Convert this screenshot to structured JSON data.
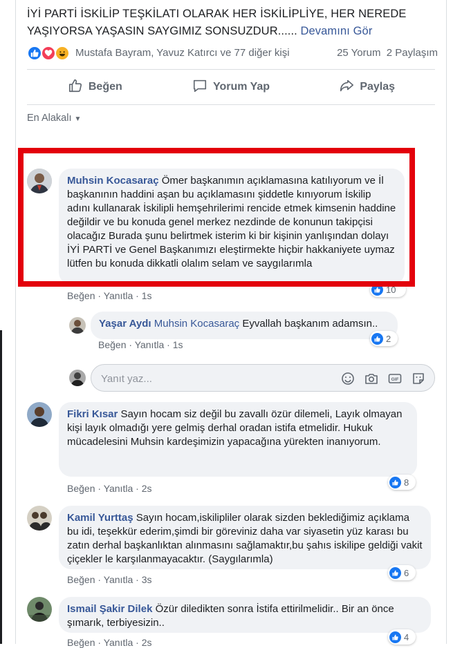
{
  "post": {
    "text_line1": "İYİ PARTİ İSKİLİP TEŞKİLATI OLARAK HER İSKİLİPLİYE, HER NEREDE",
    "text_line2": "YAŞIYORSA YAŞASIN SAYGIMIZ SONSUZDUR......",
    "see_more": "Devamını Gör",
    "reaction_names": "Mustafa Bayram, Yavuz Katırcı ve 77 diğer kişi",
    "comment_count": "25 Yorum",
    "share_count": "2 Paylaşım"
  },
  "actions": {
    "like": "Beğen",
    "comment": "Yorum Yap",
    "share": "Paylaş"
  },
  "sort": {
    "label": "En Alakalı"
  },
  "comments": [
    {
      "author": "Muhsin Kocasaraç",
      "text": "Ömer başkanımın açıklamasına katılıyorum ve İl başkanının haddini aşan bu açıklamasını şiddetle kınıyorum İskilip adını kullanarak İskilipli hemşehrilerimi rencide etmek kimsenin haddine değildir ve bu konuda genel merkez nezdinde de konunun takipçisi olacağız Burada şunu belirtmek isterim ki bir kişinin yanlışından dolayı İYİ PARTİ ve Genel Başkanımızı eleştirmekte hiçbir hakkaniyete uymaz lütfen bu konuda dikkatli olalım selam ve saygılarımla",
      "like": "Beğen",
      "reply": "Yanıtla",
      "time": "1s",
      "reactions": "10"
    },
    {
      "author": "Yaşar Aydı",
      "mention": "Muhsin Kocasaraç",
      "text": "Eyvallah başkanım adamsın..",
      "like": "Beğen",
      "reply": "Yanıtla",
      "time": "1s",
      "reactions": "2"
    },
    {
      "author": "Fikri Kısar",
      "text": "Sayın hocam siz değil bu zavallı özür dilemeli, Layık olmayan kişi layık olmadığı yere gelmiş derhal oradan istifa etmelidir. Hukuk mücadelesini Muhsin kardeşimizin yapacağına yürekten inanıyorum.",
      "like": "Beğen",
      "reply": "Yanıtla",
      "time": "2s",
      "reactions": "8"
    },
    {
      "author": "Kamil Yurttaş",
      "text": "Sayın hocam,iskilipliler olarak sizden beklediğimiz açıklama bu idi, teşekkür ederim,şimdi bir göreviniz daha var siyasetin yüz karası bu zatın derhal başkanlıktan alınmasını sağlamaktır,bu şahıs iskilipe geldiği vakit çiçekler le karşılanmayacaktır. (Saygılarımla)",
      "like": "Beğen",
      "reply": "Yanıtla",
      "time": "3s",
      "reactions": "6"
    },
    {
      "author": "Ismail Şakir Dilek",
      "text": "Özür diledikten sonra İstifa ettirilmelidir.. Bir an önce şımarık, terbiyesizin..",
      "like": "Beğen",
      "reply": "Yanıtla",
      "time": "2s",
      "reactions": "4"
    }
  ],
  "reply_box": {
    "placeholder": "Yanıt yaz..."
  },
  "icons": {
    "like": "thumbs-up-icon",
    "comment": "speech-bubble-icon",
    "share": "share-arrow-icon",
    "emoji": "smiley-icon",
    "camera": "camera-icon",
    "gif": "gif-icon",
    "sticker": "sticker-icon"
  },
  "colors": {
    "link": "#385898",
    "like_blue": "#1877f2",
    "highlight_red": "#e3000b",
    "bubble_bg": "#f0f2f5"
  }
}
